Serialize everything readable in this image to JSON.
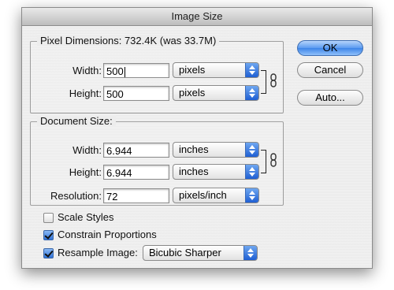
{
  "dialog": {
    "title": "Image Size"
  },
  "pixel_dimensions": {
    "title": "Pixel Dimensions:",
    "summary": "732.4K (was 33.7M)",
    "width": {
      "label": "Width:",
      "value": "500",
      "unit": "pixels"
    },
    "height": {
      "label": "Height:",
      "value": "500",
      "unit": "pixels"
    }
  },
  "document_size": {
    "title": "Document Size:",
    "width": {
      "label": "Width:",
      "value": "6.944",
      "unit": "inches"
    },
    "height": {
      "label": "Height:",
      "value": "6.944",
      "unit": "inches"
    },
    "resolution": {
      "label": "Resolution:",
      "value": "72",
      "unit": "pixels/inch"
    }
  },
  "buttons": {
    "ok": "OK",
    "cancel": "Cancel",
    "auto": "Auto..."
  },
  "options": {
    "scale_styles": {
      "label": "Scale Styles",
      "checked": false
    },
    "constrain_proportions": {
      "label": "Constrain Proportions",
      "checked": true
    },
    "resample_image": {
      "label": "Resample Image:",
      "checked": true,
      "method": "Bicubic Sharper"
    }
  },
  "colors": {
    "accent": "#3d85e8",
    "window_bg": "#ededed"
  }
}
